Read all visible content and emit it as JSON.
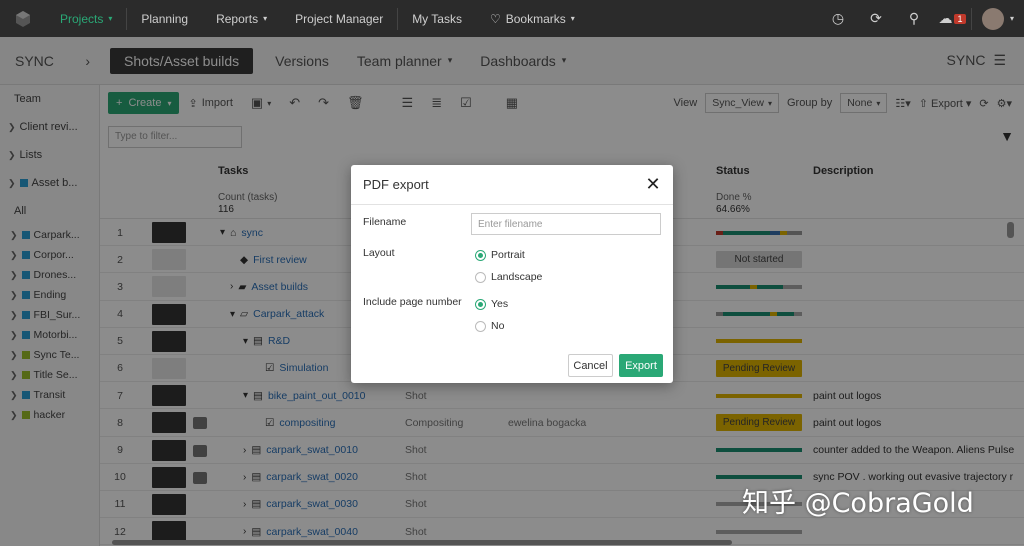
{
  "topnav": {
    "items": [
      {
        "label": "Projects",
        "active": true,
        "caret": true
      },
      {
        "label": "Planning",
        "active": false,
        "caret": false
      },
      {
        "label": "Reports",
        "active": false,
        "caret": true
      },
      {
        "label": "Project Manager",
        "active": false,
        "caret": false
      },
      {
        "label": "My Tasks",
        "active": false,
        "caret": false
      },
      {
        "label": "Bookmarks",
        "active": false,
        "caret": true
      }
    ],
    "notification_count": "1"
  },
  "subheader": {
    "workspace": "SYNC",
    "tabs": [
      "Shots/Asset builds",
      "Versions",
      "Team planner",
      "Dashboards"
    ],
    "right_label": "SYNC"
  },
  "sidebar": {
    "team_label": "Team",
    "groups": [
      "Client revi...",
      "Lists",
      "Asset b..."
    ],
    "all_label": "All",
    "projects": [
      {
        "label": "Carpark...",
        "color": "#2a9fd6"
      },
      {
        "label": "Corpor...",
        "color": "#2a9fd6"
      },
      {
        "label": "Drones...",
        "color": "#2a9fd6"
      },
      {
        "label": "Ending",
        "color": "#2a9fd6"
      },
      {
        "label": "FBI_Sur...",
        "color": "#2a9fd6"
      },
      {
        "label": "Motorbi...",
        "color": "#2a9fd6"
      },
      {
        "label": "Sync Te...",
        "color": "#9bbf2a"
      },
      {
        "label": "Title Se...",
        "color": "#9bbf2a"
      },
      {
        "label": "Transit",
        "color": "#2a9fd6"
      },
      {
        "label": "hacker",
        "color": "#9bbf2a"
      }
    ]
  },
  "toolbar": {
    "create": "Create",
    "import": "Import",
    "view_label": "View",
    "view_value": "Sync_View",
    "group_label": "Group by",
    "group_value": "None",
    "export": "Export"
  },
  "filter": {
    "placeholder": "Type to filter..."
  },
  "table": {
    "columns": {
      "tasks": "Tasks",
      "status": "Status",
      "description": "Description"
    },
    "summary": {
      "count_label": "Count (tasks)",
      "count_value": "116",
      "done_label": "Done %",
      "done_value": "64.66%"
    },
    "rows": [
      {
        "num": "1",
        "name": "sync",
        "indent": 10,
        "type": "",
        "assignee": "",
        "status": "",
        "desc": ""
      },
      {
        "num": "2",
        "name": "First review",
        "indent": 30,
        "type": "",
        "assignee": "",
        "status": "Not started",
        "desc": ""
      },
      {
        "num": "3",
        "name": "Asset builds",
        "indent": 20,
        "type": "",
        "assignee": "",
        "status": "",
        "desc": ""
      },
      {
        "num": "4",
        "name": "Carpark_attack",
        "indent": 20,
        "type": "",
        "assignee": "",
        "status": "",
        "desc": ""
      },
      {
        "num": "5",
        "name": "R&D",
        "indent": 33,
        "type": "",
        "assignee": "",
        "status": "",
        "desc": ""
      },
      {
        "num": "6",
        "name": "Simulation",
        "indent": 55,
        "type": "",
        "assignee": "",
        "status": "Pending Review",
        "desc": ""
      },
      {
        "num": "7",
        "name": "bike_paint_out_0010",
        "indent": 33,
        "type": "Shot",
        "assignee": "",
        "status": "",
        "desc": "paint out logos"
      },
      {
        "num": "8",
        "name": "compositing",
        "indent": 55,
        "type": "Compositing",
        "assignee": "ewelina bogacka",
        "status": "Pending Review",
        "desc": "paint out logos"
      },
      {
        "num": "9",
        "name": "carpark_swat_0010",
        "indent": 33,
        "type": "Shot",
        "assignee": "",
        "status": "",
        "desc": "counter added to the Weapon.  Aliens Pulse"
      },
      {
        "num": "10",
        "name": "carpark_swat_0020",
        "indent": 33,
        "type": "Shot",
        "assignee": "",
        "status": "",
        "desc": "sync POV . working out evasive trajectory r"
      },
      {
        "num": "11",
        "name": "carpark_swat_0030",
        "indent": 33,
        "type": "Shot",
        "assignee": "",
        "status": "",
        "desc": ""
      },
      {
        "num": "12",
        "name": "carpark_swat_0040",
        "indent": 33,
        "type": "Shot",
        "assignee": "",
        "status": "",
        "desc": ""
      }
    ]
  },
  "dialog": {
    "title": "PDF export",
    "filename_label": "Filename",
    "filename_placeholder": "Enter filename",
    "layout_label": "Layout",
    "portrait": "Portrait",
    "landscape": "Landscape",
    "page_number_label": "Include page number",
    "yes": "Yes",
    "no": "No",
    "cancel": "Cancel",
    "export": "Export"
  },
  "watermark": "知乎 @CobraGold",
  "colors": {
    "accent": "#2aa876",
    "topbar": "#2b2b2b",
    "pending": "#e0b400",
    "link": "#2a6fb8"
  }
}
